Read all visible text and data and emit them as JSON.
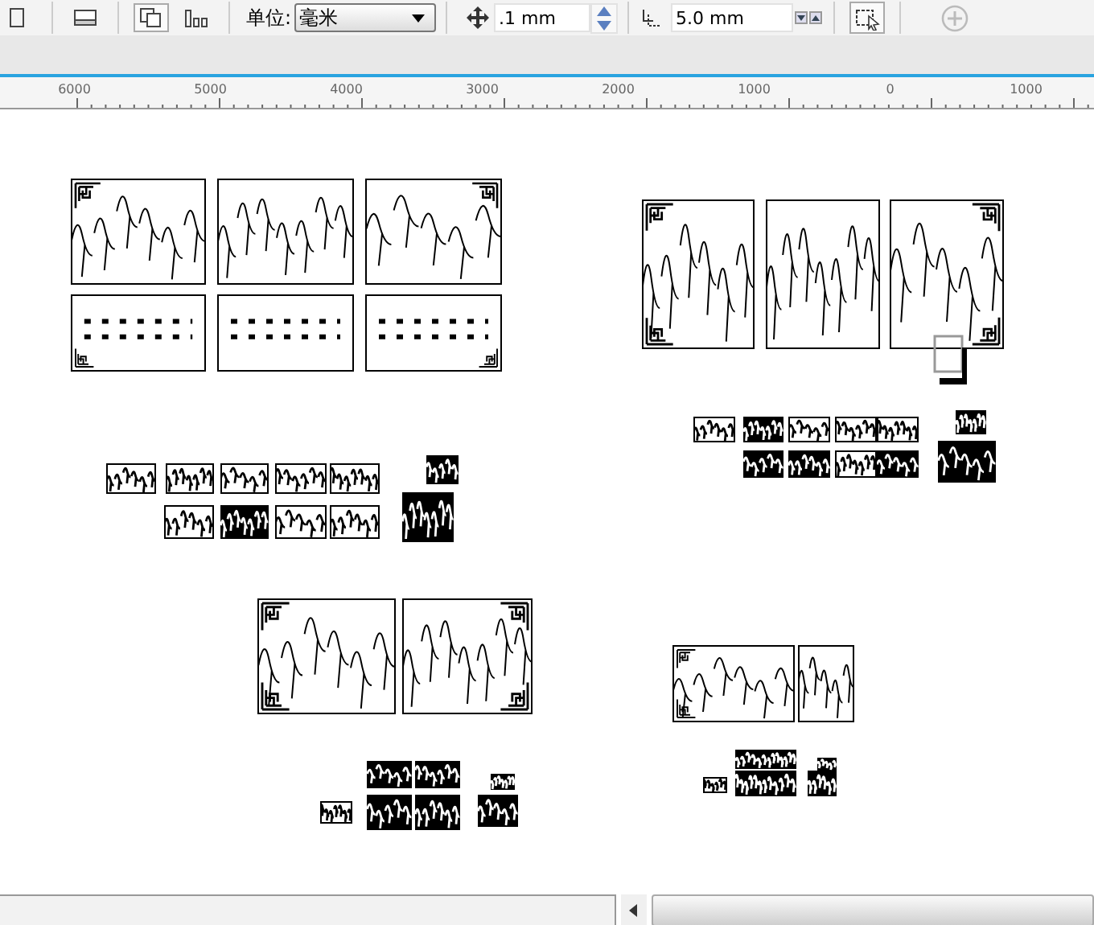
{
  "toolbar": {
    "unit_label": "单位:",
    "unit_value": "毫米",
    "nudge_value": ".1 mm",
    "duplicate_y_value": "5.0 mm"
  },
  "ruler": {
    "labels": [
      "6000",
      "5000",
      "4000",
      "3000",
      "2000",
      "1000",
      "0",
      "1000"
    ]
  }
}
